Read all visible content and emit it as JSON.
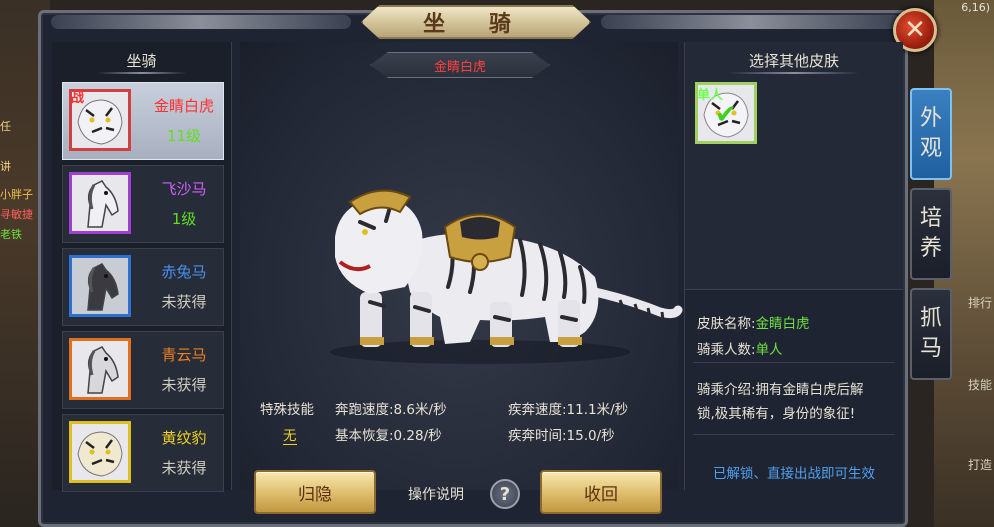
{
  "window": {
    "title": "坐 骑",
    "close_icon": "close-icon"
  },
  "background": {
    "coord": "6,16)",
    "left_texts": [
      "任",
      "讲",
      "小胖子",
      "寻敏捷",
      "老铁"
    ],
    "right_texts": [
      "排行",
      "技能",
      "打造"
    ]
  },
  "mount_list": {
    "heading": "坐骑",
    "items": [
      {
        "name": "金睛白虎",
        "status": "11级",
        "tag": "战",
        "name_color": "#ff3030",
        "status_color": "#60e020",
        "border": "#d04040",
        "selected": true
      },
      {
        "name": "飞沙马",
        "status": "1级",
        "tag": "",
        "name_color": "#d060ff",
        "status_color": "#60e020",
        "border": "#a040d0",
        "selected": false
      },
      {
        "name": "赤兔马",
        "status": "未获得",
        "tag": "",
        "name_color": "#4a90f0",
        "status_color": "#d0ccc0",
        "border": "#3070d0",
        "selected": false
      },
      {
        "name": "青云马",
        "status": "未获得",
        "tag": "",
        "name_color": "#f08020",
        "status_color": "#d0ccc0",
        "border": "#e07020",
        "selected": false
      },
      {
        "name": "黄纹豹",
        "status": "未获得",
        "tag": "",
        "name_color": "#f0d020",
        "status_color": "#d0ccc0",
        "border": "#e0c020",
        "selected": false
      }
    ]
  },
  "preview": {
    "mount_name": "金睛白虎",
    "special_skill_label": "特殊技能",
    "special_skill_value": "无",
    "run_speed": "奔跑速度:8.6米/秒",
    "sprint_speed": "疾奔速度:11.1米/秒",
    "base_recovery": "基本恢复:0.28/秒",
    "sprint_time": "疾奔时间:15.0/秒",
    "hide_button": "归隐",
    "help_label": "操作说明",
    "help_icon": "?",
    "recall_button": "收回"
  },
  "skins": {
    "heading": "选择其他皮肤",
    "selected_skin_label": "单人",
    "skin_name_label": "皮肤名称:",
    "skin_name_value": "金睛白虎",
    "riders_label": "骑乘人数:",
    "riders_value": "单人",
    "intro_line1": "骑乘介绍:拥有金睛白虎后解",
    "intro_line2": "锁,极其稀有，身份的象征!",
    "unlock_text": "已解锁、直接出战即可生效"
  },
  "side_tabs": [
    {
      "label_top": "外",
      "label_bottom": "观",
      "active": true
    },
    {
      "label_top": "培",
      "label_bottom": "养",
      "active": false
    },
    {
      "label_top": "抓",
      "label_bottom": "马",
      "active": false
    }
  ]
}
